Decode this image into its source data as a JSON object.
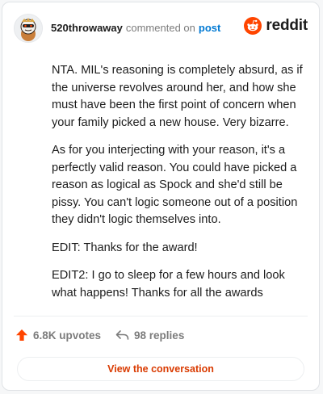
{
  "comment": {
    "username": "520throwaway",
    "action_text": "commented on",
    "post_link_text": "post",
    "paragraphs": [
      "NTA. MIL's reasoning is completely absurd, as if the universe revolves around her, and how she must have been the first point of concern when your family picked a new house. Very bizarre.",
      "As for you interjecting with your reason, it's a perfectly valid reason. You could have picked a reason as logical as Spock and she'd still be pissy. You can't logic someone out of a position they didn't logic themselves into.",
      "EDIT: Thanks for the award!",
      "EDIT2: I go to sleep for a few hours and look what happens! Thanks for all the awards"
    ]
  },
  "brand": {
    "name": "reddit",
    "color": "#ff4500"
  },
  "stats": {
    "upvotes": "6.8K upvotes",
    "replies": "98 replies"
  },
  "cta_label": "View the conversation",
  "colors": {
    "accent_link": "#0079d3",
    "upvote": "#ff4500",
    "cta_text": "#d93a00",
    "muted": "#7c7c7c"
  },
  "icons": [
    "avatar",
    "reddit-logo-icon",
    "upvote-arrow-icon",
    "reply-arrow-icon"
  ]
}
